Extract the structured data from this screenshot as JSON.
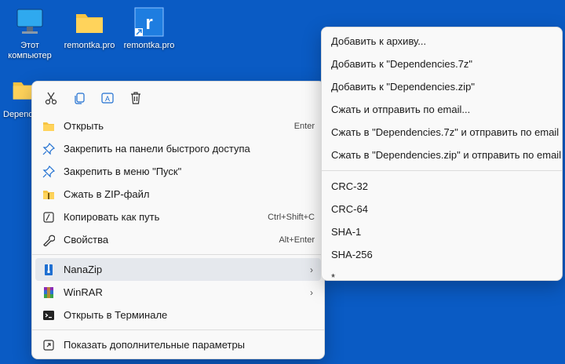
{
  "desktop": {
    "icons": [
      {
        "label": "Этот компьютер",
        "icon": "computer-icon"
      },
      {
        "label": "remontka.pro",
        "icon": "folder-icon"
      },
      {
        "label": "remontka.pro",
        "icon": "shortcut-icon"
      },
      {
        "label": "Depende",
        "icon": "folder-icon"
      }
    ]
  },
  "context_menu": {
    "toolbar": [
      "cut-icon",
      "copy-icon",
      "rename-icon",
      "delete-icon"
    ],
    "items": [
      {
        "label": "Открыть",
        "shortcut": "Enter",
        "icon": "folder-open-icon"
      },
      {
        "label": "Закрепить на панели быстрого доступа",
        "shortcut": "",
        "icon": "pin-icon"
      },
      {
        "label": "Закрепить в меню \"Пуск\"",
        "shortcut": "",
        "icon": "pin-icon"
      },
      {
        "label": "Сжать в ZIP-файл",
        "shortcut": "",
        "icon": "zip-icon"
      },
      {
        "label": "Копировать как путь",
        "shortcut": "Ctrl+Shift+C",
        "icon": "path-icon"
      },
      {
        "label": "Свойства",
        "shortcut": "Alt+Enter",
        "icon": "wrench-icon"
      },
      {
        "label": "NanaZip",
        "shortcut": "",
        "icon": "nanazip-icon",
        "submenu": true
      },
      {
        "label": "WinRAR",
        "shortcut": "",
        "icon": "winrar-icon",
        "submenu": true
      },
      {
        "label": "Открыть в Терминале",
        "shortcut": "",
        "icon": "terminal-icon"
      },
      {
        "label": "Показать дополнительные параметры",
        "shortcut": "",
        "icon": "more-options-icon"
      }
    ]
  },
  "submenu": {
    "items": [
      "Добавить к архиву...",
      "Добавить к \"Dependencies.7z\"",
      "Добавить к \"Dependencies.zip\"",
      "Сжать и отправить по email...",
      "Сжать в \"Dependencies.7z\" и отправить по email",
      "Сжать в \"Dependencies.zip\" и отправить по email",
      "CRC-32",
      "CRC-64",
      "SHA-1",
      "SHA-256",
      "*"
    ]
  },
  "colors": {
    "desktop": "#0a5bc4",
    "menu_bg": "#f9f9f9",
    "highlight": "#e5e8ed"
  }
}
